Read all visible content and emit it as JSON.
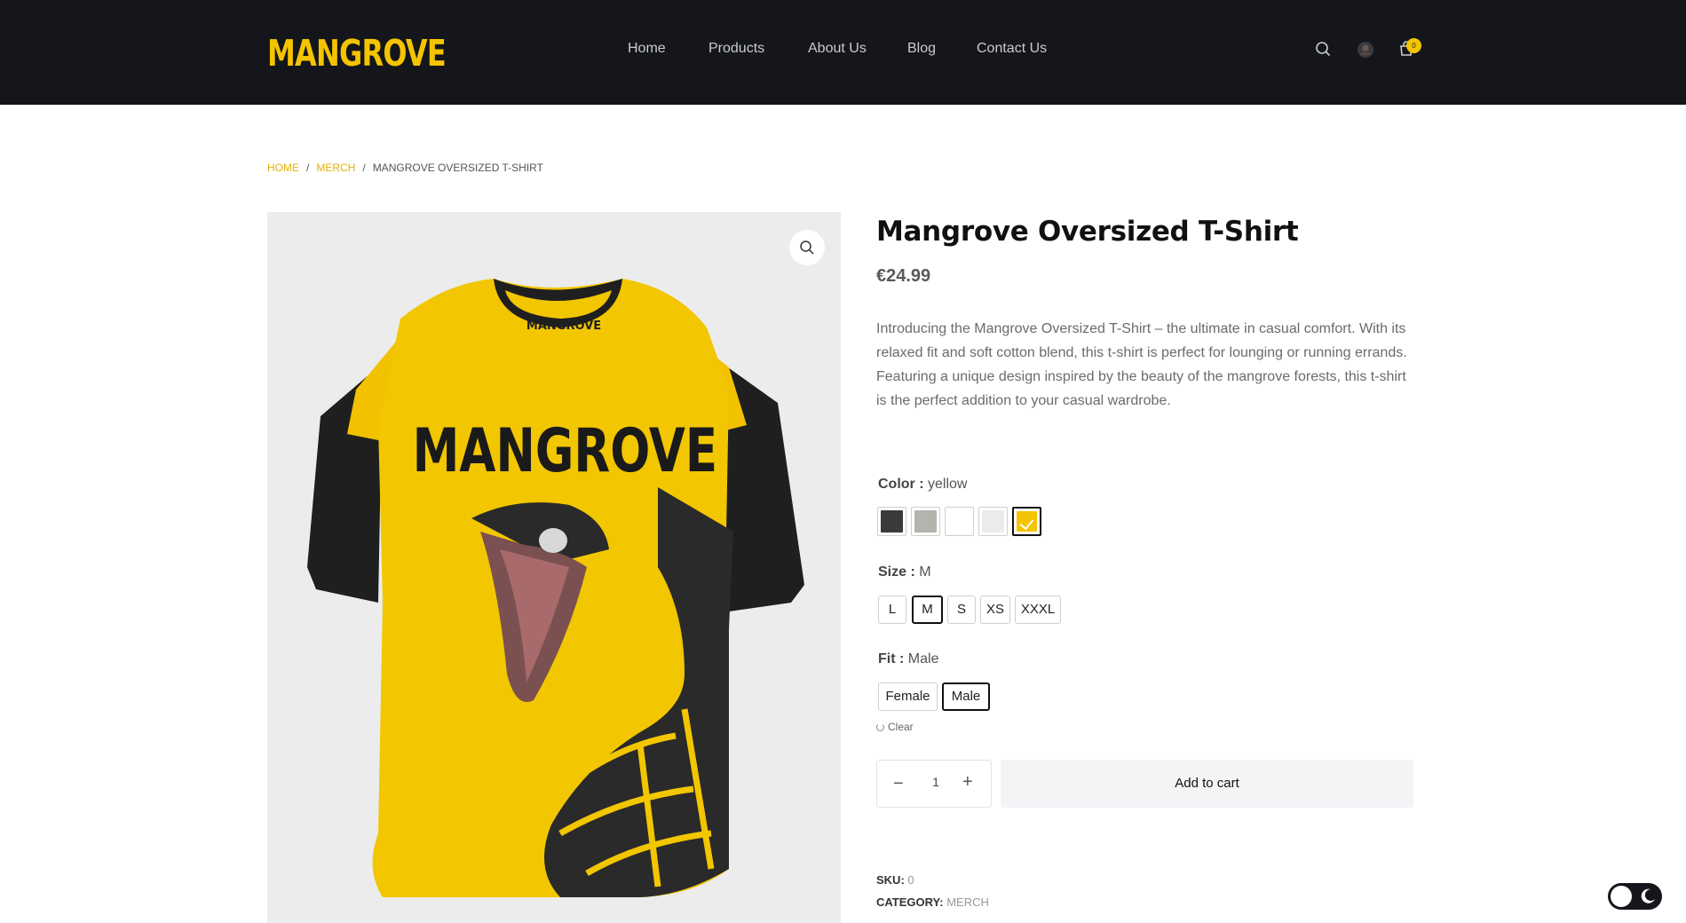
{
  "header": {
    "logo": "MANGROVE",
    "nav": [
      {
        "label": "Home"
      },
      {
        "label": "Products"
      },
      {
        "label": "About Us"
      },
      {
        "label": "Blog"
      },
      {
        "label": "Contact Us"
      }
    ],
    "icons": [
      "search-icon",
      "account-icon",
      "cart-icon"
    ],
    "cart_count": "0",
    "colors": {
      "background": "#14161b",
      "accent": "#f5c400"
    }
  },
  "breadcrumb": {
    "items": [
      "HOME",
      "MERCH",
      "MANGROVE OVERSIZED T-SHIRT"
    ],
    "separator": "/"
  },
  "product": {
    "title": "Mangrove Oversized T-Shirt",
    "price": "€24.99",
    "description": "Introducing the Mangrove Oversized T-Shirt – the ultimate in casual comfort. With its relaxed fit and soft cotton blend, this t-shirt is perfect for lounging or running errands. Featuring a unique design inspired by the beauty of the mangrove forests, this t-shirt is the perfect addition to your casual wardrobe.",
    "image_print": "MANGROVE",
    "collar_print": "MANGROVE",
    "attributes": {
      "color": {
        "label": "Color :",
        "selected": "yellow",
        "swatches": [
          {
            "color": "#3a3a3a"
          },
          {
            "color": "#b5b3ad"
          },
          {
            "color": "#ffffff"
          },
          {
            "color": "#ebebeb"
          },
          {
            "color": "#f5c400",
            "selected": true
          }
        ]
      },
      "size": {
        "label": "Size :",
        "selected": "M",
        "options": [
          "L",
          "M",
          "S",
          "XS",
          "XXXL"
        ]
      },
      "fit": {
        "label": "Fit :",
        "selected": "Male",
        "options": [
          "Female",
          "Male"
        ]
      }
    },
    "clear_label": "Clear",
    "quantity": "1",
    "qty_minus": "−",
    "qty_plus": "+",
    "add_to_cart": "Add to cart",
    "meta": {
      "sku_label": "SKU:",
      "sku_value": "0",
      "category_label": "CATEGORY:",
      "category_value": "MERCH"
    }
  }
}
